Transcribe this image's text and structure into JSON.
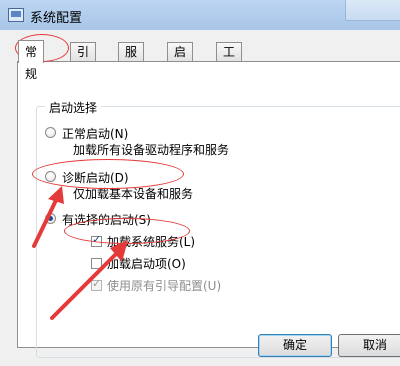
{
  "window": {
    "title": "系统配置"
  },
  "tabs": [
    {
      "label": "常规"
    },
    {
      "label": "引导"
    },
    {
      "label": "服务"
    },
    {
      "label": "启动"
    },
    {
      "label": "工具"
    }
  ],
  "startup_group": {
    "title": "启动选择",
    "normal": {
      "label": "正常启动(N)",
      "desc": "加载所有设备驱动程序和服务"
    },
    "diagnostic": {
      "label": "诊断启动(D)",
      "desc": "仅加载基本设备和服务"
    },
    "selective": {
      "label": "有选择的启动(S)"
    },
    "options": [
      {
        "label": "加载系统服务(L)",
        "checked": true,
        "enabled": true
      },
      {
        "label": "加载启动项(O)",
        "checked": false,
        "enabled": true
      },
      {
        "label": "使用原有引导配置(U)",
        "checked": true,
        "enabled": false
      }
    ]
  },
  "buttons": {
    "ok": "确定",
    "cancel": "取消"
  },
  "annotation_color": "#e53a3a"
}
